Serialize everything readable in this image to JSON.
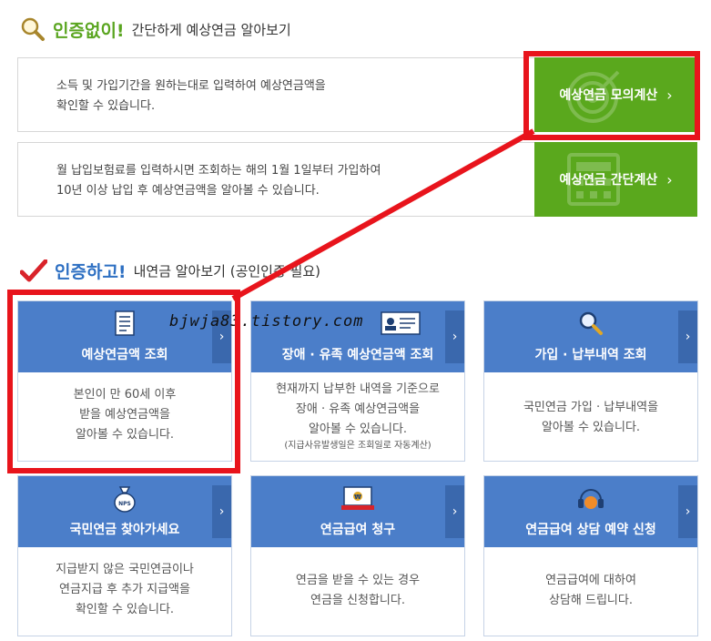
{
  "section1": {
    "highlight": "인증없이!",
    "subtitle": "간단하게 예상연금 알아보기"
  },
  "calc_simulate": {
    "desc_line1": "소득 및 가입기간을 원하는대로 입력하여 예상연금액을",
    "desc_line2": "확인할 수 있습니다.",
    "button_label": "예상연금 모의계산"
  },
  "calc_simple": {
    "desc_line1": "월 납입보험료를 입력하시면 조회하는 해의 1월 1일부터 가입하여",
    "desc_line2": "10년 이상 납입 후 예상연금액을 알아볼 수 있습니다.",
    "button_label": "예상연금 간단계산"
  },
  "section2": {
    "highlight": "인증하고!",
    "subtitle": "내연금 알아보기 (공인인증 필요)"
  },
  "cards": [
    {
      "title": "예상연금액 조회",
      "lines": [
        "본인이 만 60세 이후",
        "받을 예상연금액을",
        "알아볼 수 있습니다."
      ],
      "note": ""
    },
    {
      "title": "장애 · 유족 예상연금액 조회",
      "lines": [
        "현재까지 납부한 내역을 기준으로",
        "장애  · 유족 예상연금액을",
        "알아볼 수 있습니다."
      ],
      "note": "(지급사유발생일은 조회일로 자동계산)"
    },
    {
      "title": "가입 · 납부내역 조회",
      "lines": [
        "국민연금 가입  · 납부내역을",
        "알아볼 수 있습니다.",
        ""
      ],
      "note": ""
    },
    {
      "title": "국민연금 찾아가세요",
      "lines": [
        "지급받지 않은 국민연금이나",
        "연금지급 후 추가 지급액을",
        "확인할 수 있습니다."
      ],
      "note": ""
    },
    {
      "title": "연금급여 청구",
      "lines": [
        "연금을 받을 수 있는 경우",
        "연금을 신청합니다.",
        ""
      ],
      "note": ""
    },
    {
      "title": "연금급여 상담 예약 신청",
      "lines": [
        "연금급여에 대하여",
        "상담해 드립니다.",
        ""
      ],
      "note": ""
    }
  ],
  "arrow_glyph": "›",
  "watermark": "bjwja83.tistory.com",
  "colors": {
    "green": "#5aa81d",
    "blue": "#4b7ec9",
    "red_annotation": "#e8141c"
  }
}
